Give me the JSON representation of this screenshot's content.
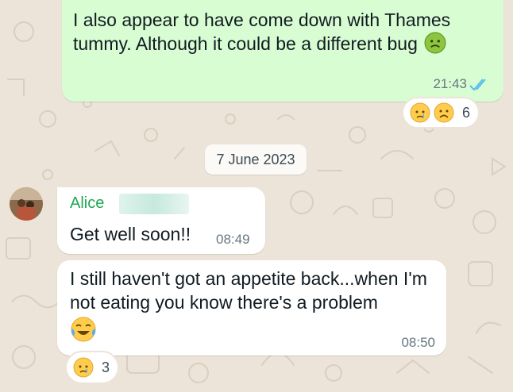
{
  "colors": {
    "background": "#ece4d8",
    "outgoing_bubble": "#d9fdd3",
    "incoming_bubble": "#ffffff",
    "sender_name": "#1fa855",
    "read_ticks": "#53bdeb",
    "timestamp": "#667781"
  },
  "messages": [
    {
      "direction": "outgoing",
      "text": "I also appear to have come down with Thames tummy. Although it could be a different bug",
      "inline_emoji": "nauseated-face-icon",
      "time": "21:43",
      "status_icon": "double-check-read-icon",
      "reactions": {
        "emojis": [
          "crying-face-icon",
          "frowning-face-icon"
        ],
        "count": "6"
      }
    },
    {
      "direction": "incoming",
      "sender": "Alice",
      "text": "Get well soon!!",
      "time": "08:49"
    },
    {
      "direction": "incoming",
      "text": "I still haven't got an appetite back...when I'm not eating you know there's a problem",
      "inline_emoji": "tears-of-joy-icon",
      "time": "08:50",
      "reactions": {
        "emojis": [
          "crying-face-icon"
        ],
        "count": "3"
      }
    }
  ],
  "date_separator": "7 June 2023"
}
